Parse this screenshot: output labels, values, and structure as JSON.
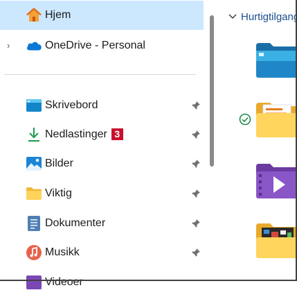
{
  "nav": {
    "items": [
      {
        "label": "Hjem",
        "icon": "home-icon",
        "selected": true
      },
      {
        "label": "OneDrive - Personal",
        "icon": "onedrive-cloud-icon",
        "expandable": true
      },
      {
        "label": "Skrivebord",
        "icon": "desktop-icon",
        "pinned": true
      },
      {
        "label": "Nedlastinger",
        "icon": "download-icon",
        "pinned": true,
        "badge": "3"
      },
      {
        "label": "Bilder",
        "icon": "pictures-icon",
        "pinned": true
      },
      {
        "label": "Viktig",
        "icon": "folder-icon",
        "pinned": true
      },
      {
        "label": "Dokumenter",
        "icon": "documents-icon",
        "pinned": true
      },
      {
        "label": "Musikk",
        "icon": "music-icon",
        "pinned": true
      },
      {
        "label": "Videoer",
        "icon": "videos-icon"
      }
    ]
  },
  "content": {
    "section_title": "Hurtigtilgang",
    "folders": [
      {
        "icon": "desktop-folder-icon",
        "status": ""
      },
      {
        "icon": "folder-with-documents-icon",
        "status": "synced-check-icon"
      },
      {
        "icon": "videos-folder-icon",
        "status": ""
      },
      {
        "icon": "folder-with-images-icon",
        "status": ""
      }
    ]
  },
  "colors": {
    "selected_bg": "#cce8ff",
    "accent": "#0067c0",
    "badge": "#c8102e",
    "section_text": "#1a4d8f"
  }
}
